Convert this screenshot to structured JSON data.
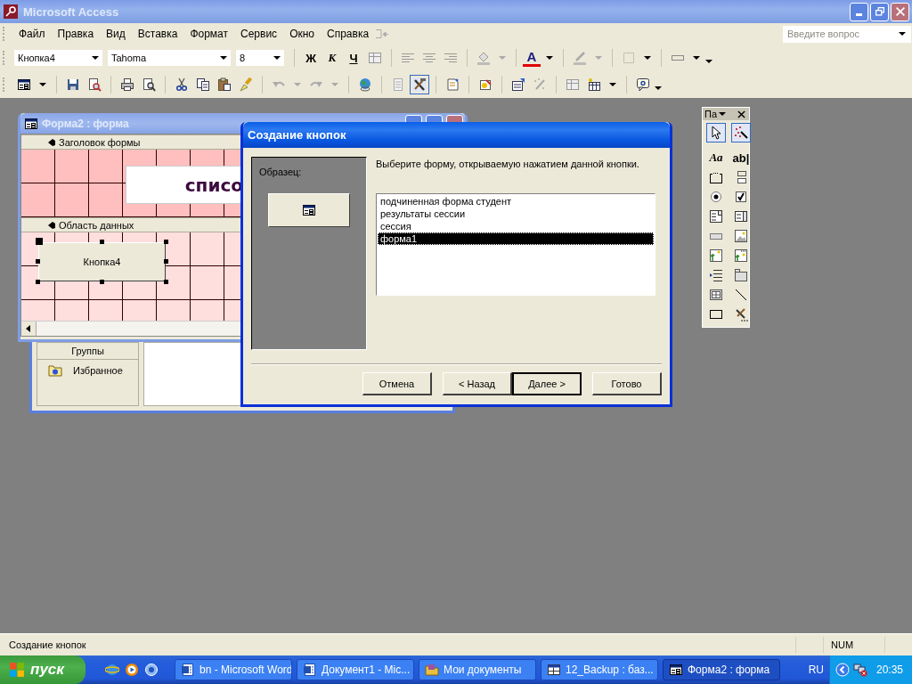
{
  "app": {
    "title": "Microsoft Access",
    "help_placeholder": "Введите вопрос"
  },
  "menu": [
    "Файл",
    "Правка",
    "Вид",
    "Вставка",
    "Формат",
    "Сервис",
    "Окно",
    "Справка"
  ],
  "format_toolbar": {
    "object": "Кнопка4",
    "font": "Tahoma",
    "size": "8",
    "bold": "Ж",
    "italic": "К",
    "underline": "Ч",
    "font_color_glyph": "A"
  },
  "form_window": {
    "title": "Форма2 : форма",
    "header_section": "Заголовок формы",
    "header_label": "списо",
    "detail_section": "Область данных",
    "button_caption": "Кнопка4"
  },
  "db_window": {
    "groups_heading": "Группы",
    "favorites": "Избранное"
  },
  "dialog": {
    "title": "Создание кнопок",
    "sample_label": "Образец:",
    "prompt": "Выберите форму, открываемую нажатием данной кнопки.",
    "items": [
      {
        "label": "подчиненная форма студент",
        "selected": false
      },
      {
        "label": "результаты сессии",
        "selected": false
      },
      {
        "label": "сессия",
        "selected": false
      },
      {
        "label": "форма1",
        "selected": true
      }
    ],
    "buttons": [
      {
        "label": "Отмена",
        "default": false
      },
      {
        "label": "< Назад",
        "default": false
      },
      {
        "label": "Далее >",
        "default": true
      },
      {
        "label": "Готово",
        "default": false
      }
    ]
  },
  "toolbox": {
    "title": "Па",
    "tools": [
      {
        "kind": "pointer",
        "on": true
      },
      {
        "kind": "wizard",
        "on": true
      },
      {
        "kind": "label",
        "glyph": "Aa",
        "on": false
      },
      {
        "kind": "textbox",
        "glyph": "ab|",
        "on": false
      },
      {
        "kind": "option-group",
        "on": false
      },
      {
        "kind": "toggle",
        "on": false
      },
      {
        "kind": "radio",
        "on": false
      },
      {
        "kind": "checkbox",
        "on": false
      },
      {
        "kind": "combo",
        "on": false
      },
      {
        "kind": "listbox",
        "on": false
      },
      {
        "kind": "command",
        "on": false
      },
      {
        "kind": "image",
        "on": false
      },
      {
        "kind": "unbound-frame",
        "on": false
      },
      {
        "kind": "bound-frame",
        "on": false
      },
      {
        "kind": "page-break",
        "on": false
      },
      {
        "kind": "tab-control",
        "on": false
      },
      {
        "kind": "subform",
        "on": false
      },
      {
        "kind": "line",
        "on": false
      },
      {
        "kind": "rectangle",
        "on": false
      },
      {
        "kind": "more",
        "on": false
      }
    ]
  },
  "status_bar": {
    "text": "Создание кнопок",
    "num": "NUM"
  },
  "taskbar": {
    "start": "пуск",
    "tasks": [
      {
        "label": "bn - Microsoft Word",
        "kind": "word",
        "selected": false
      },
      {
        "label": "Документ1 - Mic...",
        "kind": "word",
        "selected": false
      },
      {
        "label": "Мои документы",
        "kind": "folder",
        "selected": false
      },
      {
        "label": "12_Backup : баз...",
        "kind": "database",
        "selected": false
      },
      {
        "label": "Форма2 : форма",
        "kind": "form",
        "selected": true
      }
    ],
    "language": "RU",
    "clock": "20:35"
  }
}
